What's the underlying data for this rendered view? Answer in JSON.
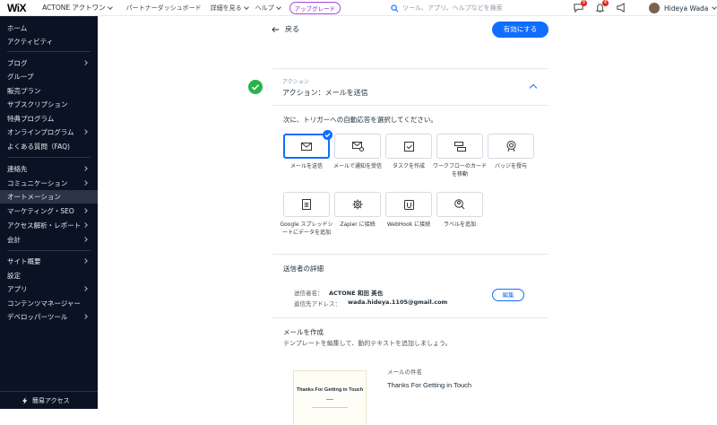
{
  "topbar": {
    "logo": "WiX",
    "site_name": "ACTONE アクトワン",
    "nav": [
      "パートナーダッシュボード",
      "詳細を見る",
      "ヘルプ"
    ],
    "upgrade": "アップグレード",
    "search_placeholder": "ツール、アプリ、ヘルプなどを検索",
    "notif_counts": [
      "8",
      "4"
    ],
    "user_name": "Hideya Wada"
  },
  "sidebar": {
    "items": [
      "ホーム",
      "アクティビティ",
      "ブログ",
      "グループ",
      "販売プラン",
      "サブスクリプション",
      "特典プログラム",
      "オンラインプログラム",
      "よくある質問（FAQ)",
      "連絡先",
      "コミュニケーション",
      "オートメーション",
      "マーケティング・SEO",
      "アクセス解析・レポート",
      "会計",
      "サイト概要",
      "設定",
      "アプリ",
      "コンテンツマネージャー",
      "デベロッパーツール"
    ],
    "footer": "簡易アクセス"
  },
  "header": {
    "back": "戻る",
    "enable_button": "有効にする"
  },
  "action": {
    "small_label": "アクション",
    "title": "アクション：メールを送信"
  },
  "prompt": "次に、トリガーへの自動応答を選択してください。",
  "tiles": [
    {
      "caption": "メールを送信",
      "icon": "mail-icon"
    },
    {
      "caption": "メールで通知を受信",
      "icon": "mail-notify-icon"
    },
    {
      "caption": "タスクを作成",
      "icon": "task-check-icon"
    },
    {
      "caption": "ワークフローのカードを移動",
      "icon": "workflow-card-icon"
    },
    {
      "caption": "バッジを授与",
      "icon": "badge-icon"
    },
    {
      "caption": "Google スプレッドシートにデータを追加",
      "icon": "spreadsheet-icon"
    },
    {
      "caption": "Zapier に接続",
      "icon": "gear-icon"
    },
    {
      "caption": "WebHook に接続",
      "icon": "webhook-icon"
    },
    {
      "caption": "ラベルを追加",
      "icon": "label-icon"
    }
  ],
  "sender": {
    "section_title": "送信者の詳細",
    "name_label": "送信者名：",
    "name_value": "ACTONE 和田 英也",
    "reply_label": "返信先アドレス：",
    "reply_value": "wada.hideya.1105@gmail.com",
    "edit": "編集"
  },
  "compose": {
    "title": "メールを作成",
    "subtitle": "テンプレートを編集して、動的テキストを追加しましょう。",
    "preview_heading": "Thanks For Getting in Touch",
    "subject_label": "メールの件名",
    "subject_value": "Thanks For Getting in Touch"
  },
  "colors": {
    "accent": "#116dff",
    "sidebar": "#0b1223",
    "success": "#2bb24c"
  }
}
